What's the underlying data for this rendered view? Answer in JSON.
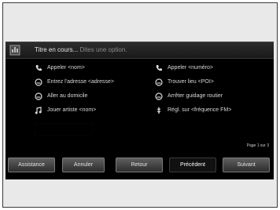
{
  "header": {
    "title": "Titre en cours...",
    "hint": "Dites une option."
  },
  "commands": [
    {
      "icon": "phone-icon",
      "label": "Appeler <nom>"
    },
    {
      "icon": "phone-icon",
      "label": "Appeler <numéro>"
    },
    {
      "icon": "navigation-icon",
      "label": "Entrez l'adresse <adresse>"
    },
    {
      "icon": "navigation-icon",
      "label": "Trouver lieu <POI>"
    },
    {
      "icon": "navigation-icon",
      "label": "Aller au domicile"
    },
    {
      "icon": "navigation-icon",
      "label": "Arrêter guidage routier"
    },
    {
      "icon": "music-note-icon",
      "label": "Jouer artiste <nom>"
    },
    {
      "icon": "radio-icon",
      "label": "Régl. sur <fréquence FM>"
    }
  ],
  "page_indicator": "Page 1 sur 3",
  "buttons": [
    {
      "label": "Assistance"
    },
    {
      "label": "Annuler"
    },
    {
      "label": "Retour"
    },
    {
      "label": "Précédent"
    },
    {
      "label": "Suivant"
    }
  ]
}
